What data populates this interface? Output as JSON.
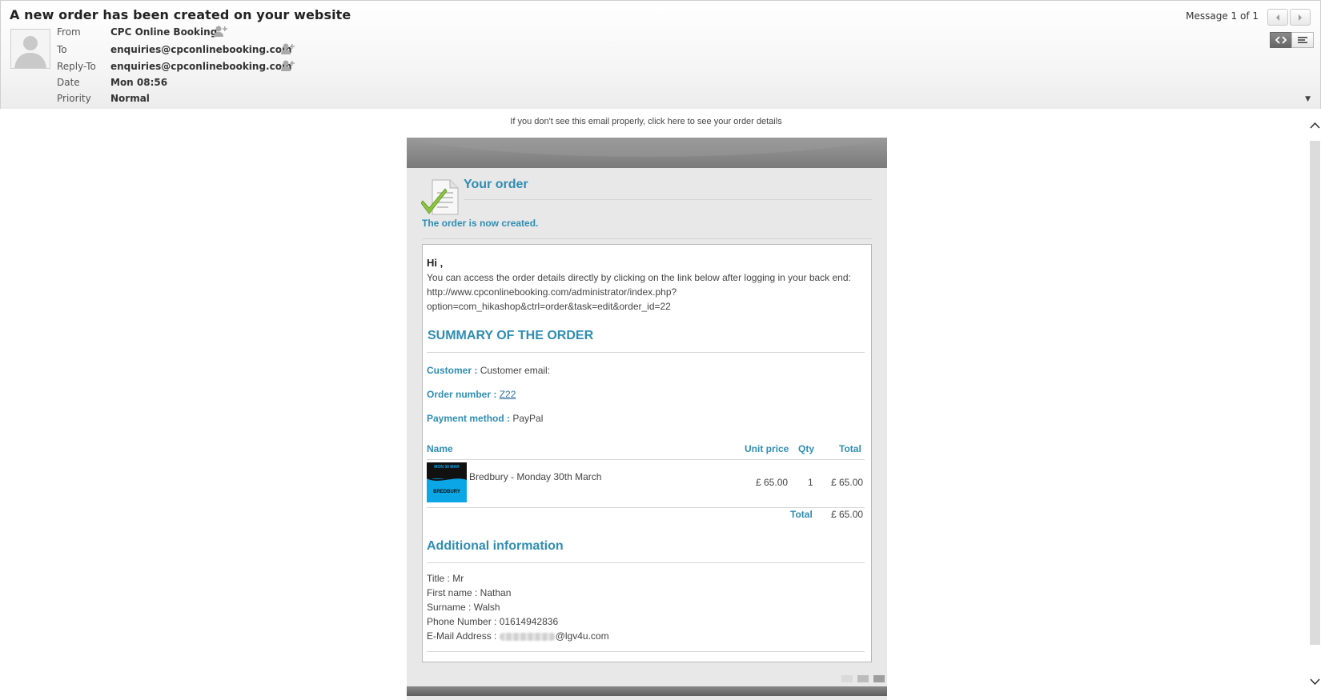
{
  "header": {
    "subject": "A new order has been created on your website",
    "from_label": "From",
    "from_value": "CPC Online Booking",
    "to_label": "To",
    "to_value": "enquiries@cpconlinebooking.com",
    "replyto_label": "Reply-To",
    "replyto_value": "enquiries@cpconlinebooking.com",
    "date_label": "Date",
    "date_value": "Mon 08:56",
    "priority_label": "Priority",
    "priority_value": "Normal",
    "message_count": "Message 1 of 1"
  },
  "email": {
    "notice": "If you don't see this email properly, click here to see your order details",
    "your_order": "Your order",
    "created": "The order is now created.",
    "hi": "Hi ,",
    "intro": "You can access the order details directly by clicking on the link below after logging in your back end:",
    "link_line1": "http://www.cpconlinebooking.com/administrator/index.php?",
    "link_line2": "option=com_hikashop&ctrl=order&task=edit&order_id=22",
    "summary_title": "SUMMARY OF THE ORDER",
    "customer_label": "Customer :",
    "customer_value": "Customer email:",
    "order_number_label": "Order number :",
    "order_number_value": "Z22",
    "payment_label": "Payment method :",
    "payment_value": "PayPal",
    "table": {
      "col_name": "Name",
      "col_unit_price": "Unit price",
      "col_qty": "Qty",
      "col_total": "Total",
      "rows": [
        {
          "thumb_top": "MON 30 MAR",
          "thumb_bottom": "BREDBURY",
          "name": "Bredbury - Monday 30th March",
          "unit_price": "£ 65.00",
          "qty": "1",
          "total": "£ 65.00"
        }
      ],
      "total_label": "Total",
      "total_value": "£ 65.00"
    },
    "additional_title": "Additional information",
    "info": {
      "title": "Title : Mr",
      "first_name": "First name : Nathan",
      "surname": "Surname : Walsh",
      "phone": "Phone Number : 01614942836",
      "email_label": "E-Mail Address : ",
      "email_domain": "@lgv4u.com"
    }
  },
  "colors": {
    "accent": "#2f8db3",
    "card_bg": "#e8e8e8"
  }
}
